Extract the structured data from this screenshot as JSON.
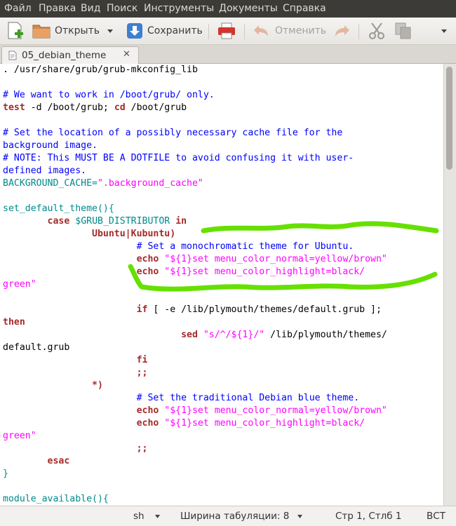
{
  "menubar": {
    "items": [
      "Файл",
      "Правка",
      "Вид",
      "Поиск",
      "Инструменты",
      "Документы",
      "Справка"
    ]
  },
  "toolbar": {
    "open_label": "Открыть",
    "save_label": "Сохранить",
    "undo_label": "Отменить"
  },
  "tab": {
    "title": "05_debian_theme",
    "close": "✕"
  },
  "code_lines": [
    [
      [
        "t",
        ". /usr/share/grub/grub-mkconfig_lib"
      ]
    ],
    [],
    [
      [
        "c",
        "# We want to work in /boot/grub/ only."
      ]
    ],
    [
      [
        "k",
        "test"
      ],
      [
        "t",
        " -d /boot/grub; "
      ],
      [
        "k",
        "cd"
      ],
      [
        "t",
        " /boot/grub"
      ]
    ],
    [],
    [
      [
        "c",
        "# Set the location of a possibly necessary cache file for the"
      ]
    ],
    [
      [
        "c",
        "background image."
      ]
    ],
    [
      [
        "c",
        "# NOTE: This MUST BE A DOTFILE to avoid confusing it with user-"
      ]
    ],
    [
      [
        "c",
        "defined images."
      ]
    ],
    [
      [
        "v",
        "BACKGROUND_CACHE="
      ],
      [
        "s",
        "\".background_cache\""
      ]
    ],
    [],
    [
      [
        "v",
        "set_default_theme(){"
      ]
    ],
    [
      [
        "t",
        "        "
      ],
      [
        "k",
        "case"
      ],
      [
        "t",
        " "
      ],
      [
        "v",
        "$GRUB_DISTRIBUTOR"
      ],
      [
        "t",
        " "
      ],
      [
        "k",
        "in"
      ]
    ],
    [
      [
        "t",
        "                "
      ],
      [
        "k",
        "Ubuntu|Kubuntu)"
      ]
    ],
    [
      [
        "t",
        "                        "
      ],
      [
        "c",
        "# Set a monochromatic theme for Ubuntu."
      ]
    ],
    [
      [
        "t",
        "                        "
      ],
      [
        "k",
        "echo"
      ],
      [
        "t",
        " "
      ],
      [
        "s",
        "\"${1}set menu_color_normal=yellow/brown\""
      ]
    ],
    [
      [
        "t",
        "                        "
      ],
      [
        "k",
        "echo"
      ],
      [
        "t",
        " "
      ],
      [
        "s",
        "\"${1}set menu_color_highlight=black/"
      ]
    ],
    [
      [
        "s",
        "green\""
      ]
    ],
    [],
    [
      [
        "t",
        "                        "
      ],
      [
        "k",
        "if"
      ],
      [
        "t",
        " [ -e /lib/plymouth/themes/default.grub ];"
      ]
    ],
    [
      [
        "k",
        "then"
      ]
    ],
    [
      [
        "t",
        "                                "
      ],
      [
        "k",
        "sed"
      ],
      [
        "t",
        " "
      ],
      [
        "s",
        "\"s/^/${1}/\""
      ],
      [
        "t",
        " /lib/plymouth/themes/"
      ]
    ],
    [
      [
        "t",
        "default.grub"
      ]
    ],
    [
      [
        "t",
        "                        "
      ],
      [
        "k",
        "fi"
      ]
    ],
    [
      [
        "t",
        "                        "
      ],
      [
        "k",
        ";;"
      ]
    ],
    [
      [
        "t",
        "                "
      ],
      [
        "k",
        "*)"
      ]
    ],
    [
      [
        "t",
        "                        "
      ],
      [
        "c",
        "# Set the traditional Debian blue theme."
      ]
    ],
    [
      [
        "t",
        "                        "
      ],
      [
        "k",
        "echo"
      ],
      [
        "t",
        " "
      ],
      [
        "s",
        "\"${1}set menu_color_normal=yellow/brown\""
      ]
    ],
    [
      [
        "t",
        "                        "
      ],
      [
        "k",
        "echo"
      ],
      [
        "t",
        " "
      ],
      [
        "s",
        "\"${1}set menu_color_highlight=black/"
      ]
    ],
    [
      [
        "s",
        "green\""
      ]
    ],
    [
      [
        "t",
        "                        "
      ],
      [
        "k",
        ";;"
      ]
    ],
    [
      [
        "t",
        "        "
      ],
      [
        "k",
        "esac"
      ]
    ],
    [
      [
        "v",
        "}"
      ]
    ],
    [],
    [
      [
        "v",
        "module_available(){"
      ]
    ]
  ],
  "statusbar": {
    "language": "sh",
    "tab_width": "Ширина табуляции:  8",
    "position": "Стр 1, Стлб 1",
    "mode": "ВСТ"
  },
  "colors": {
    "keyword": "#a52a2a",
    "comment": "#0000ff",
    "string": "#ff00ff",
    "variable": "#008a8c",
    "marker": "#66e000"
  }
}
